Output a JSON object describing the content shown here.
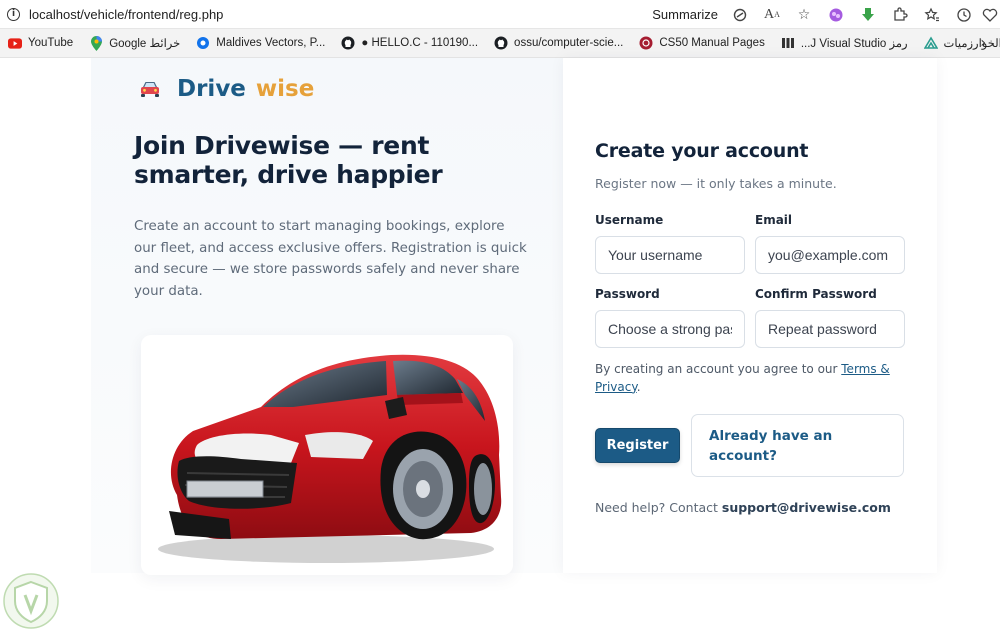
{
  "browser": {
    "url": "localhost/vehicle/frontend/reg.php",
    "summarize_label": "Summarize",
    "bookmarks": [
      {
        "label": "YouTube",
        "icon": "youtube-icon"
      },
      {
        "label": "Google خرائط",
        "icon": "google-maps-icon"
      },
      {
        "label": "Maldives Vectors, P...",
        "icon": "freepik-icon"
      },
      {
        "label": "● HELLO.C - 110190...",
        "icon": "github-icon"
      },
      {
        "label": "ossu/computer-scie...",
        "icon": "github-icon"
      },
      {
        "label": "CS50 Manual Pages",
        "icon": "cs50-icon"
      },
      {
        "label": "...J Visual Studio رمز",
        "icon": "bookmark-icon"
      },
      {
        "label": "الخوارزميات",
        "icon": "algorithms-icon"
      }
    ]
  },
  "brand": {
    "part1": "Drive",
    "part2": "wise"
  },
  "hero": {
    "title": "Join Drivewise — rent smarter, drive happier",
    "description": "Create an account to start managing bookings, explore our fleet, and access exclusive offers. Registration is quick and secure — we store passwords safely and never share your data."
  },
  "form": {
    "title": "Create your account",
    "subtitle": "Register now — it only takes a minute.",
    "username_label": "Username",
    "username_placeholder": "Your username",
    "email_label": "Email",
    "email_placeholder": "you@example.com",
    "password_label": "Password",
    "password_placeholder": "Choose a strong pas",
    "confirm_label": "Confirm Password",
    "confirm_placeholder": "Repeat password",
    "terms_prefix": "By creating an account you agree to our ",
    "terms_link": "Terms & Privacy",
    "terms_suffix": ".",
    "register_label": "Register",
    "login_label": "Already have an account?",
    "help_prefix": "Need help? Contact ",
    "help_email": "support@drivewise.com"
  },
  "colors": {
    "brand_blue": "#1c5b86",
    "brand_orange": "#e6a13a",
    "heading": "#12233a",
    "car_red": "#c8151d"
  }
}
